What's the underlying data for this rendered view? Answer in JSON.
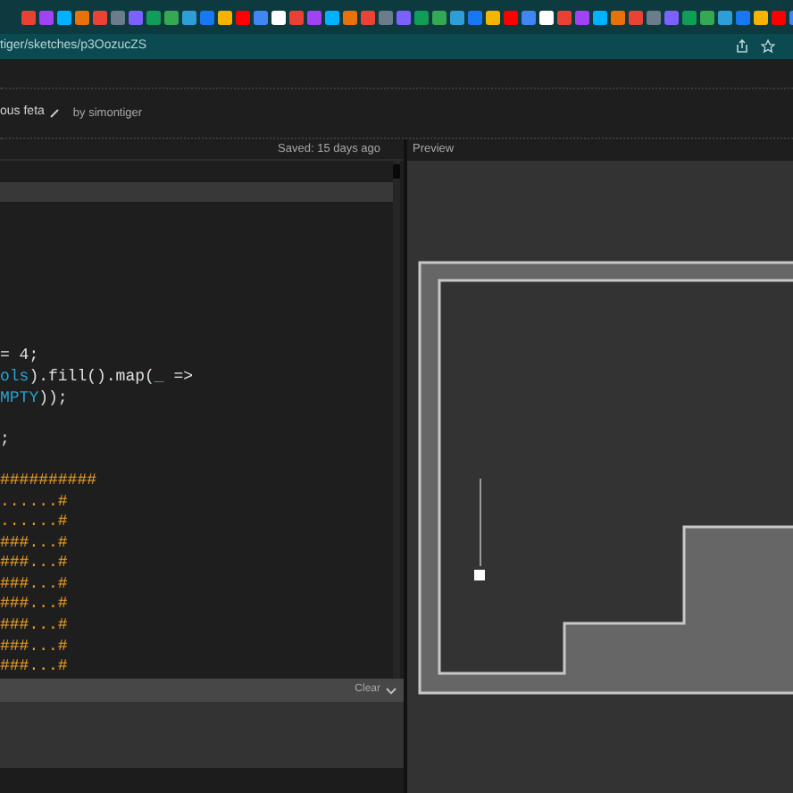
{
  "browser": {
    "url": "tiger/sketches/p3OozucZS"
  },
  "sketch": {
    "title": "ous feta",
    "author": "by simontiger"
  },
  "editor": {
    "saved": "Saved: 15 days ago",
    "lines": [
      {
        "active": false
      },
      {
        "active": true
      },
      {
        "active": false
      },
      {
        "active": false
      },
      {
        "active": false
      },
      {
        "active": false
      },
      {
        "active": false
      },
      {
        "active": false
      },
      {
        "active": false
      },
      {
        "active": false,
        "spans": [
          {
            "text": "= 4;",
            "kind": "plain"
          }
        ]
      },
      {
        "active": false,
        "spans": [
          {
            "text": "ols",
            "kind": "ident"
          },
          {
            "text": ").fill().map(",
            "kind": "plain"
          },
          {
            "text": "_",
            "kind": "ident"
          },
          {
            "text": " =>",
            "kind": "plain"
          }
        ]
      },
      {
        "active": false,
        "spans": [
          {
            "text": "MPTY",
            "kind": "ident"
          },
          {
            "text": "));",
            "kind": "plain"
          }
        ]
      },
      {
        "active": false
      },
      {
        "active": false,
        "spans": [
          {
            "text": ";",
            "kind": "plain"
          }
        ]
      },
      {
        "active": false
      },
      {
        "active": false,
        "spans": [
          {
            "text": "##########",
            "kind": "string"
          }
        ]
      },
      {
        "active": false,
        "spans": [
          {
            "text": "......#",
            "kind": "string"
          }
        ]
      },
      {
        "active": false,
        "spans": [
          {
            "text": "......#",
            "kind": "string"
          }
        ]
      },
      {
        "active": false,
        "spans": [
          {
            "text": "###...#",
            "kind": "string"
          }
        ]
      },
      {
        "active": false,
        "spans": [
          {
            "text": "###...#",
            "kind": "string"
          }
        ]
      },
      {
        "active": false,
        "spans": [
          {
            "text": "###...#",
            "kind": "string"
          }
        ]
      },
      {
        "active": false,
        "spans": [
          {
            "text": "###...#",
            "kind": "string"
          }
        ]
      },
      {
        "active": false,
        "spans": [
          {
            "text": "###...#",
            "kind": "string"
          }
        ]
      },
      {
        "active": false,
        "spans": [
          {
            "text": "###...#",
            "kind": "string"
          }
        ]
      },
      {
        "active": false,
        "spans": [
          {
            "text": "###...#",
            "kind": "string"
          }
        ]
      }
    ]
  },
  "console": {
    "clear": "Clear"
  },
  "preview": {
    "label": "Preview"
  }
}
